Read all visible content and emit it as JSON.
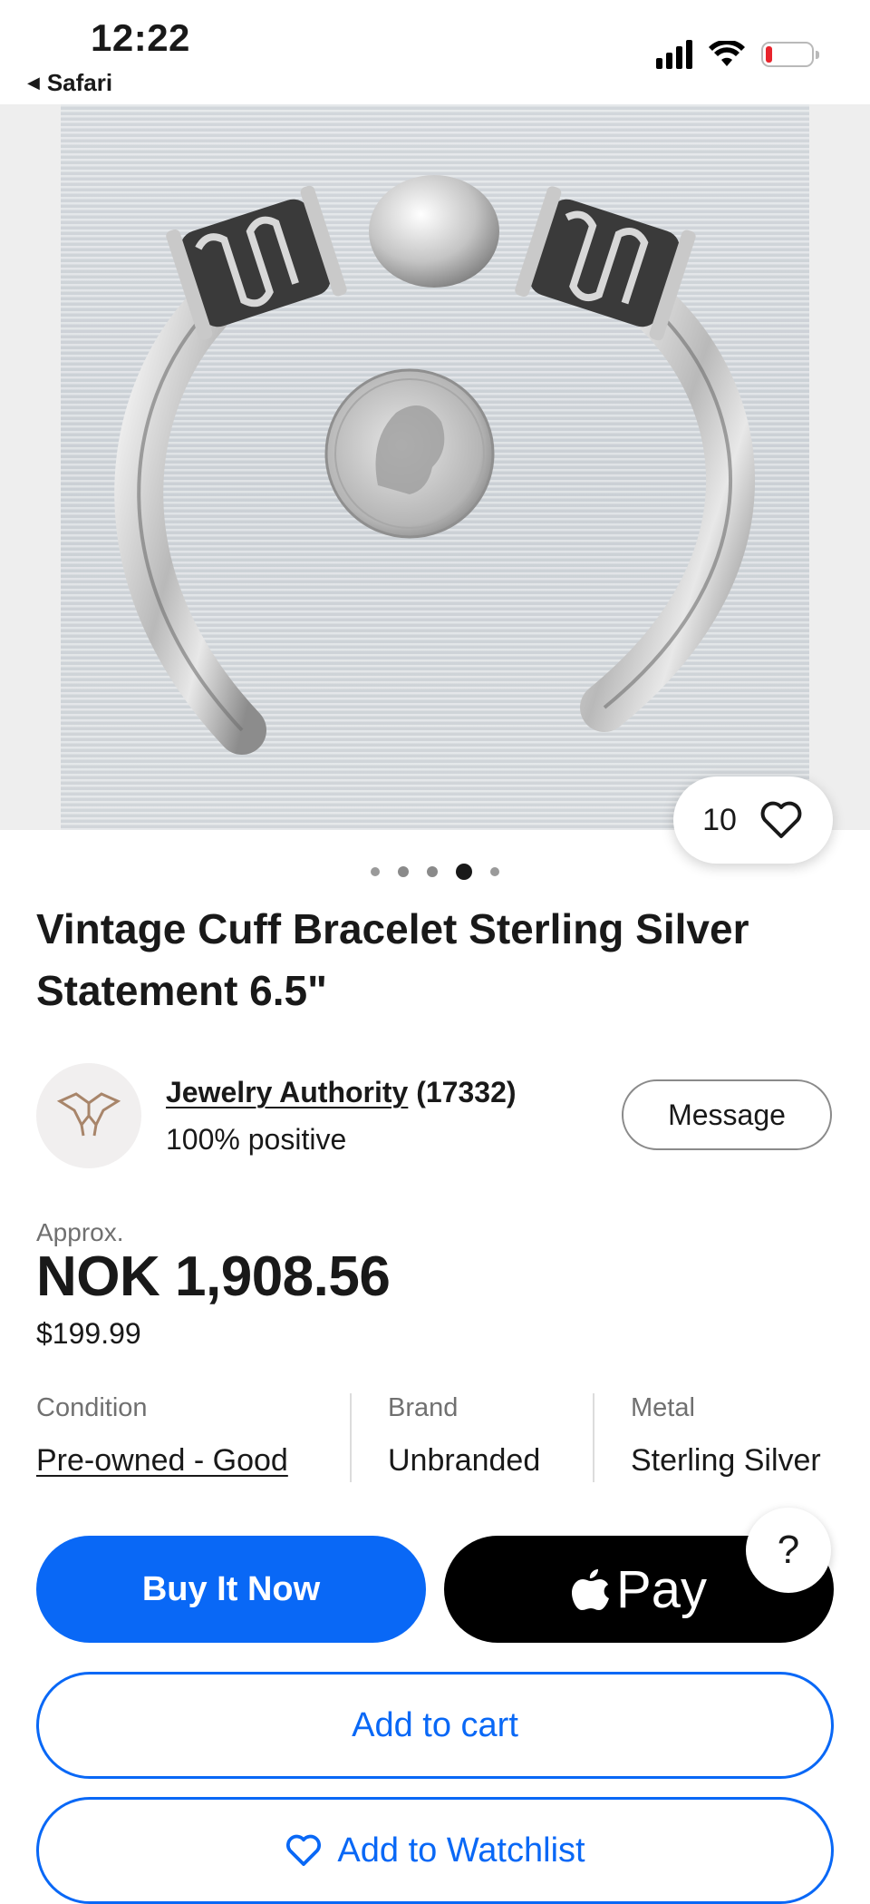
{
  "status_bar": {
    "time": "12:22",
    "back_app": "Safari"
  },
  "gallery": {
    "watch_count": "10",
    "image_count": 5,
    "active_index": 3
  },
  "product": {
    "title": "Vintage Cuff Bracelet Sterling Silver Statement 6.5\""
  },
  "seller": {
    "name": "Jewelry Authority",
    "feedback_count": "(17332)",
    "positive": "100% positive",
    "message_label": "Message"
  },
  "price": {
    "approx_label": "Approx.",
    "converted": "NOK 1,908.56",
    "original": "$199.99"
  },
  "specs": [
    {
      "label": "Condition",
      "value": "Pre-owned - Good"
    },
    {
      "label": "Brand",
      "value": "Unbranded"
    },
    {
      "label": "Metal",
      "value": "Sterling Silver"
    }
  ],
  "actions": {
    "buy_now": "Buy It Now",
    "apple_pay": "Pay",
    "help": "?",
    "add_to_cart": "Add to cart",
    "add_to_watchlist": "Add to Watchlist"
  },
  "colors": {
    "accent": "#0968f6",
    "text": "#191919",
    "muted": "#707070",
    "battery_low": "#e8242c"
  },
  "icons": [
    "signal-icon",
    "wifi-icon",
    "battery-icon",
    "heart-icon",
    "seller-logo-icon",
    "apple-logo-icon",
    "help-icon"
  ]
}
